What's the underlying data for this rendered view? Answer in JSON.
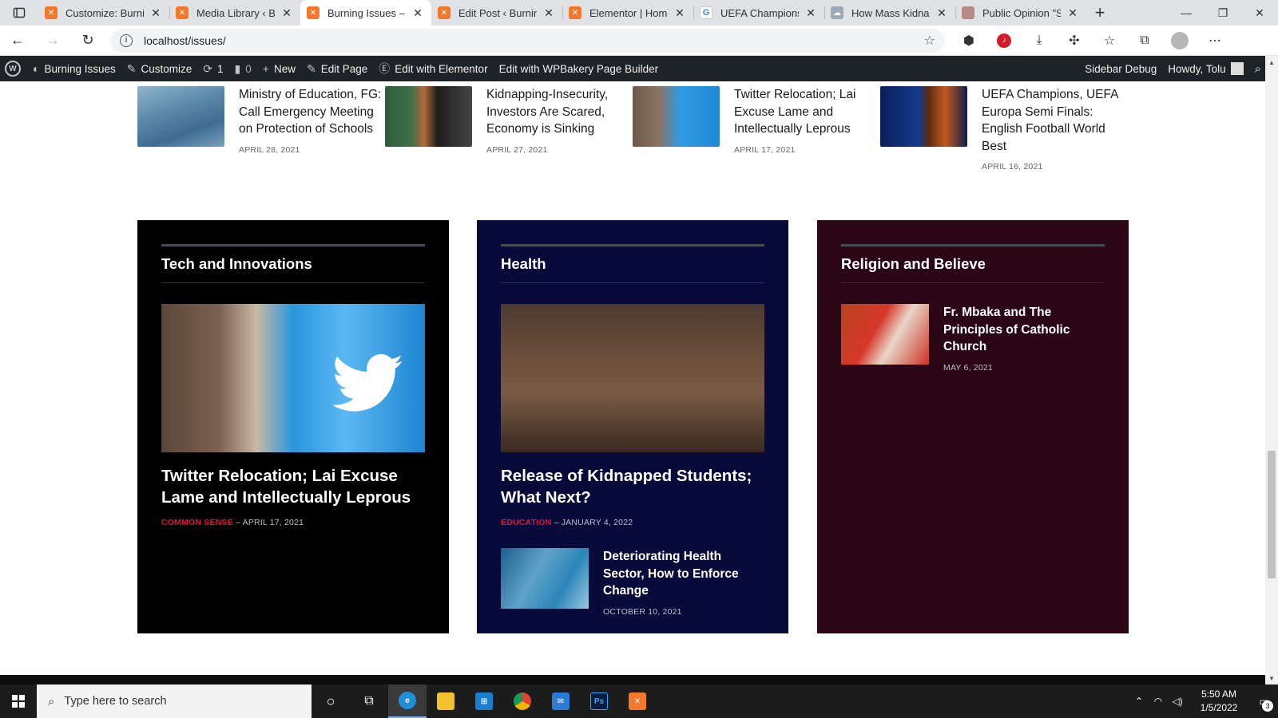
{
  "browser": {
    "tabs": [
      {
        "title": "Customize: Burning Issues",
        "favicon": "xampp-icon",
        "active": false
      },
      {
        "title": "Media Library ‹ Burning Issues",
        "favicon": "xampp-icon",
        "active": false
      },
      {
        "title": "Burning Issues – Just another",
        "favicon": "xampp-icon",
        "active": true
      },
      {
        "title": "Edit Post ‹ Burning Issues",
        "favicon": "xampp-icon",
        "active": false
      },
      {
        "title": "Elementor | Homepage",
        "favicon": "xampp-icon",
        "active": false
      },
      {
        "title": "UEFA Champions league",
        "favicon": "google-icon",
        "active": false
      },
      {
        "title": "How Mass Kidnapping",
        "favicon": "cloud-icon",
        "active": false
      },
      {
        "title": "Public Opinion \"Slap",
        "favicon": "page-icon",
        "active": false
      }
    ],
    "url": "localhost/issues/"
  },
  "wp_admin_bar": {
    "site_name": "Burning Issues",
    "customize": "Customize",
    "updates_count": "1",
    "comments_count": "0",
    "new": "New",
    "edit_page": "Edit Page",
    "edit_elementor": "Edit with Elementor",
    "edit_wpbakery": "Edit with WPBakery Page Builder",
    "sidebar_debug": "Sidebar Debug",
    "howdy": "Howdy, Tolu"
  },
  "recent_posts": [
    {
      "title": "Ministry of Education, FG: Call Emergency Meeting on Protection of Schools",
      "date": "APRIL 28, 2021"
    },
    {
      "title": "Kidnapping-Insecurity, Investors Are Scared, Economy is Sinking",
      "date": "APRIL 27, 2021"
    },
    {
      "title": "Twitter Relocation; Lai Excuse Lame and Intellectually Leprous",
      "date": "APRIL 17, 2021"
    },
    {
      "title": "UEFA Champions, UEFA Europa Semi Finals: English Football World Best",
      "date": "APRIL 16, 2021"
    }
  ],
  "panels": {
    "tech": {
      "heading": "Tech and Innovations",
      "feature_title": "Twitter Relocation; Lai Excuse Lame and Intellectually Leprous",
      "category": "COMMON SENSE",
      "date": "– APRIL 17, 2021"
    },
    "health": {
      "heading": "Health",
      "feature_title": "Release of Kidnapped Students; What Next?",
      "category": "EDUCATION",
      "date": "– JANUARY 4, 2022",
      "small_title": "Deteriorating Health Sector, How to Enforce Change",
      "small_date": "OCTOBER 10, 2021"
    },
    "religion": {
      "heading": "Religion and Believe",
      "small_title": "Fr. Mbaka and The Principles of Catholic Church",
      "small_date": "MAY 6, 2021"
    }
  },
  "taskbar": {
    "search_placeholder": "Type here to search",
    "time": "5:50 AM",
    "date": "1/5/2022",
    "notifications": "3"
  },
  "colors": {
    "accent_red": "#e2143a",
    "tech_bg": "#000000",
    "health_bg": "#080a3a",
    "religion_bg": "#2b0716",
    "wp_bar": "#1d2327"
  }
}
